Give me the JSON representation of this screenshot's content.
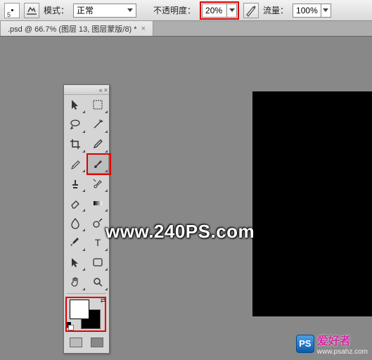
{
  "optbar": {
    "brush_size": "5",
    "mode_label": "模式：",
    "mode_value": "正常",
    "opacity_label": "不透明度：",
    "opacity_value": "20%",
    "flow_label": "流量：",
    "flow_value": "100%"
  },
  "tab": {
    "title": ".psd @ 66.7% (图层 13, 图层蒙版/8) *",
    "close": "×"
  },
  "toolbox": {
    "collapse": "«",
    "close": "×",
    "tools": [
      {
        "name": "move-tool",
        "svg": "cursor"
      },
      {
        "name": "marquee-tool",
        "svg": "marquee"
      },
      {
        "name": "lasso-tool",
        "svg": "lasso"
      },
      {
        "name": "magic-wand-tool",
        "svg": "wand"
      },
      {
        "name": "crop-tool",
        "svg": "crop"
      },
      {
        "name": "eyedropper-tool",
        "svg": "eyedrop"
      },
      {
        "name": "healing-brush-tool",
        "svg": "heal"
      },
      {
        "name": "brush-tool",
        "svg": "brush",
        "selected": true
      },
      {
        "name": "clone-stamp-tool",
        "svg": "stamp"
      },
      {
        "name": "history-brush-tool",
        "svg": "hbr"
      },
      {
        "name": "eraser-tool",
        "svg": "eraser"
      },
      {
        "name": "gradient-tool",
        "svg": "grad"
      },
      {
        "name": "blur-tool",
        "svg": "blur"
      },
      {
        "name": "dodge-tool",
        "svg": "dodge"
      },
      {
        "name": "pen-tool",
        "svg": "pen"
      },
      {
        "name": "type-tool",
        "svg": "type"
      },
      {
        "name": "path-selection-tool",
        "svg": "path"
      },
      {
        "name": "shape-tool",
        "svg": "shape"
      },
      {
        "name": "hand-tool",
        "svg": "hand"
      },
      {
        "name": "zoom-tool",
        "svg": "zoom"
      }
    ]
  },
  "watermark": {
    "main": "www.240PS.com",
    "logo": "PS",
    "text1": "爱好者",
    "text2": "www.psahz.com"
  }
}
